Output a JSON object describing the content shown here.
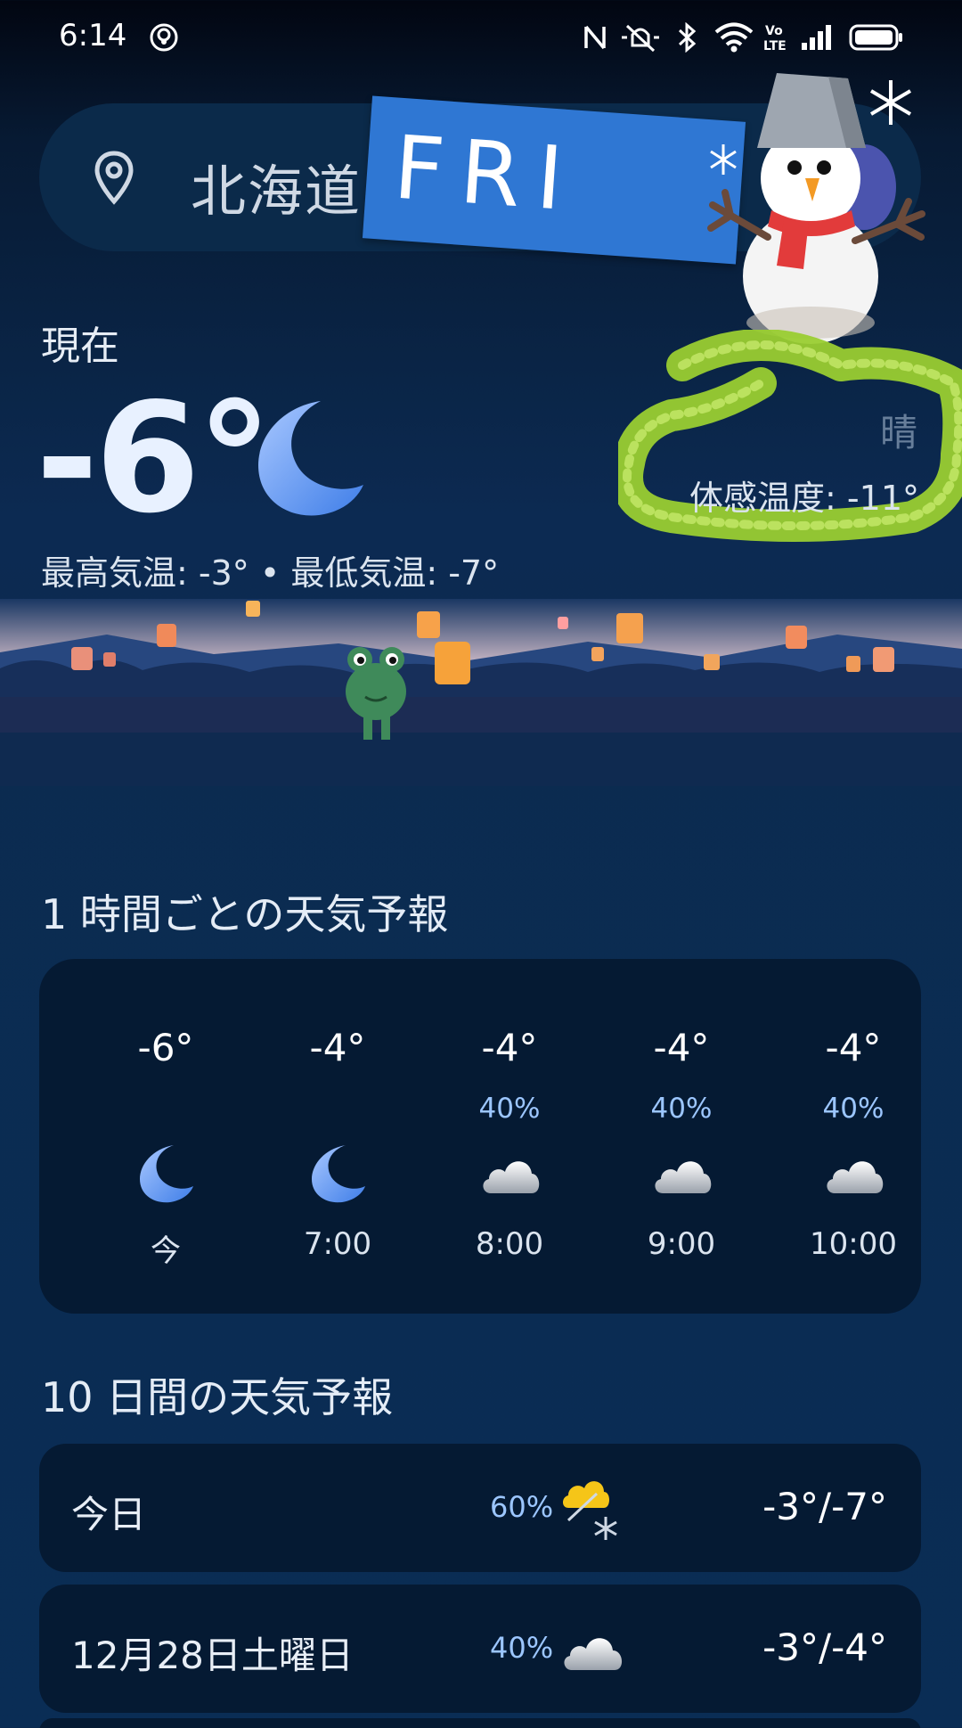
{
  "status_bar": {
    "time": "6:14"
  },
  "search": {
    "location": "北海道"
  },
  "sticker": {
    "text": "FRI"
  },
  "current": {
    "label": "現在",
    "temperature": "-6°",
    "condition_icon": "moon-icon",
    "condition_text": "晴",
    "feels_like": "体感温度: -11°",
    "hi_lo": "最高気温: -3° • 最低気温: -7°"
  },
  "hourly": {
    "title": "1 時間ごとの天気予報",
    "items": [
      {
        "temp": "-6°",
        "pop": "",
        "icon": "moon-icon",
        "label": "今"
      },
      {
        "temp": "-4°",
        "pop": "",
        "icon": "moon-icon",
        "label": "7:00"
      },
      {
        "temp": "-4°",
        "pop": "40%",
        "icon": "cloud-icon",
        "label": "8:00"
      },
      {
        "temp": "-4°",
        "pop": "40%",
        "icon": "cloud-icon",
        "label": "9:00"
      },
      {
        "temp": "-4°",
        "pop": "40%",
        "icon": "cloud-icon",
        "label": "10:00"
      }
    ]
  },
  "daily": {
    "title": "10 日間の天気予報",
    "items": [
      {
        "day": "今日",
        "pop": "60%",
        "icon": "partly-cloudy-snow-icon",
        "temps": "-3°/-7°"
      },
      {
        "day": "12月28日土曜日",
        "pop": "40%",
        "icon": "cloud-icon",
        "temps": "-3°/-4°"
      }
    ]
  },
  "colors": {
    "accent_blue": "#9cc6ff",
    "card_bg": "#051a33",
    "scribble_green": "#9acd32"
  }
}
